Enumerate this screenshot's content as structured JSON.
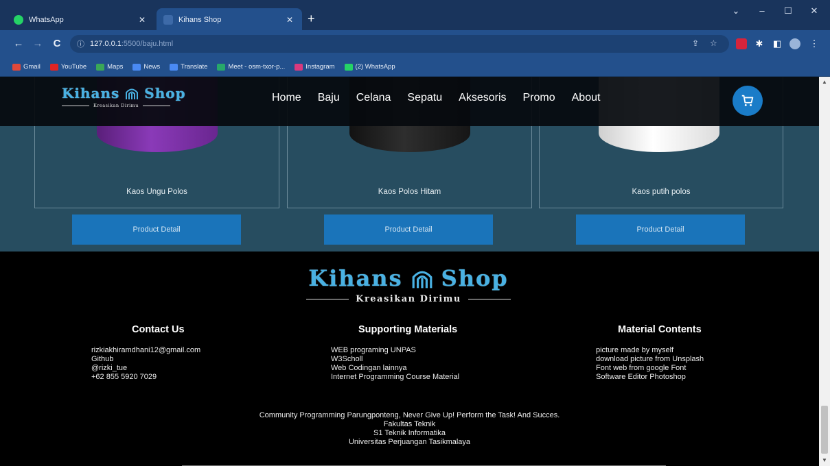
{
  "browser": {
    "tabs": [
      {
        "title": "WhatsApp",
        "icon": "whatsapp-icon",
        "active": false
      },
      {
        "title": "Kihans Shop",
        "icon": "page-icon",
        "active": true
      }
    ],
    "url_host": "127.0.0.1",
    "url_rest": ":5500/baju.html",
    "bookmarks": [
      {
        "label": "Gmail",
        "icon": "gmail-icon",
        "color": "#e0483a"
      },
      {
        "label": "YouTube",
        "icon": "youtube-icon",
        "color": "#e02424"
      },
      {
        "label": "Maps",
        "icon": "maps-icon",
        "color": "#3aa757"
      },
      {
        "label": "News",
        "icon": "news-icon",
        "color": "#4a8af4"
      },
      {
        "label": "Translate",
        "icon": "translate-icon",
        "color": "#4a8af4"
      },
      {
        "label": "Meet - osm-txor-p...",
        "icon": "meet-icon",
        "color": "#27a86a"
      },
      {
        "label": "Instagram",
        "icon": "instagram-icon",
        "color": "#d9397e"
      },
      {
        "label": "(2) WhatsApp",
        "icon": "whatsapp-icon",
        "color": "#25d366"
      }
    ]
  },
  "site": {
    "logo": {
      "name": "Kihans",
      "name2": "Shop",
      "tagline": "Kreasikan Dirimu"
    },
    "nav": [
      "Home",
      "Baju",
      "Celana",
      "Sepatu",
      "Aksesoris",
      "Promo",
      "About"
    ],
    "cart_icon": "cart-icon",
    "accent": "#1a74ba",
    "products": [
      {
        "name": "Kaos Ungu Polos",
        "color": "#7a2fa0",
        "button": "Product Detail"
      },
      {
        "name": "Kaos Polos Hitam",
        "color": "#1b1b1b",
        "button": "Product Detail"
      },
      {
        "name": "Kaos putih polos",
        "color": "#f2f2f2",
        "button": "Product Detail"
      }
    ],
    "footer": {
      "logo": {
        "name": "Kihans",
        "name2": "Shop",
        "tagline": "Kreasikan Dirimu"
      },
      "columns": [
        {
          "title": "Contact Us",
          "items": [
            "rizkiakhiramdhani12@gmail.com",
            "Github",
            "@rizki_tue",
            "+62 855 5920 7029"
          ]
        },
        {
          "title": "Supporting Materials",
          "items": [
            "WEB programing UNPAS",
            "W3Scholl",
            "Web Codingan lainnya",
            "Internet Programming Course Material"
          ]
        },
        {
          "title": "Material Contents",
          "items": [
            "picture made by myself",
            "download picture from Unsplash",
            "Font web from google Font",
            "Software Editor Photoshop"
          ]
        }
      ],
      "credits": [
        "Community Programming Parungponteng, Never Give Up! Perform the Task! And Succes.",
        "Fakultas Teknik",
        "S1 Teknik Informatika",
        "Universitas Perjuangan Tasikmalaya"
      ]
    }
  }
}
